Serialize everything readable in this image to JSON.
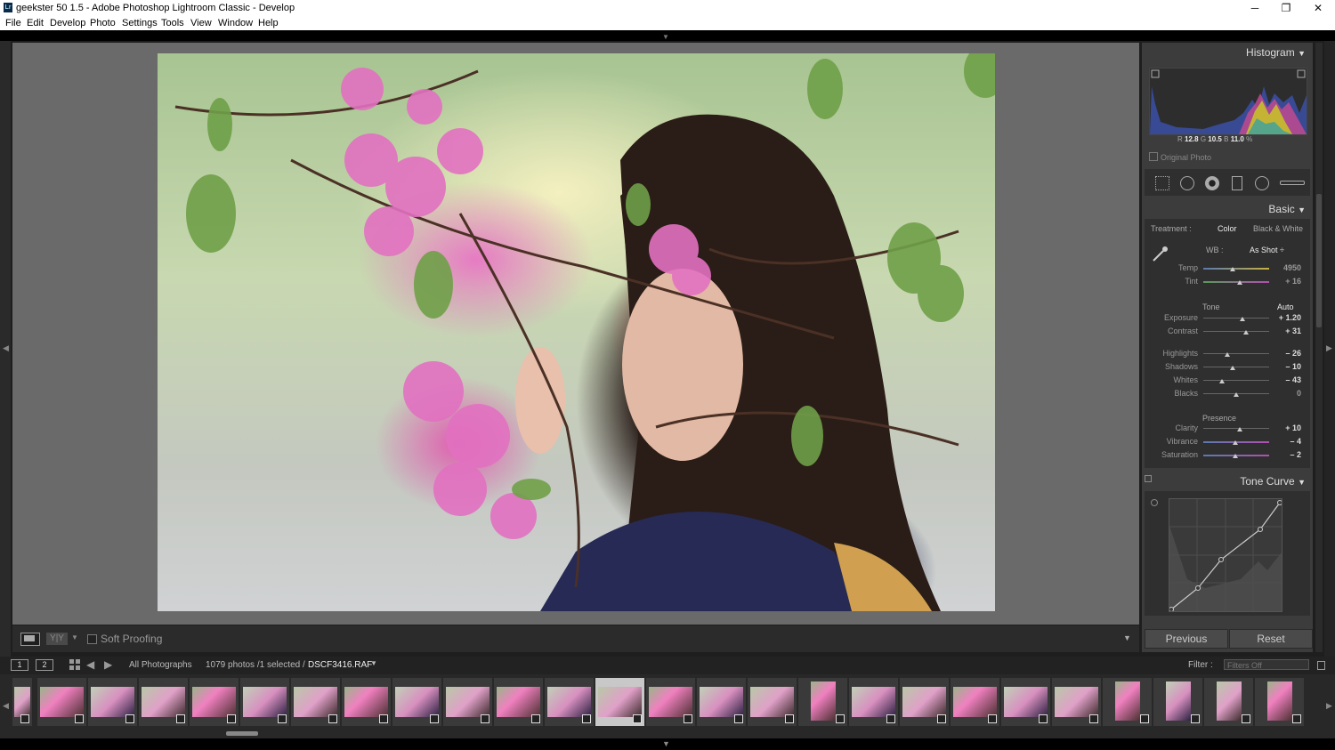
{
  "window": {
    "title": "geekster 50 1.5 - Adobe Photoshop Lightroom Classic - Develop",
    "app_icon": "Lr",
    "minimize": "─",
    "maximize": "❐",
    "close": "✕"
  },
  "menu": [
    "File",
    "Edit",
    "Develop",
    "Photo",
    "Settings",
    "Tools",
    "View",
    "Window",
    "Help"
  ],
  "toolbar": {
    "soft_proofing": "Soft Proofing",
    "view_mode": "Y|Y"
  },
  "histogram": {
    "title": "Histogram",
    "r_label": "R",
    "r": "12.8",
    "g_label": "G",
    "g": "10.5",
    "b_label": "B",
    "b": "11.0",
    "unit": "%",
    "original_photo": "Original Photo"
  },
  "basic": {
    "title": "Basic",
    "treatment_label": "Treatment :",
    "treatment_color": "Color",
    "treatment_bw": "Black & White",
    "wb_label": "WB :",
    "wb_value": "As Shot ÷",
    "temp": {
      "label": "Temp",
      "value": "4950",
      "level": 0.45
    },
    "tint": {
      "label": "Tint",
      "value": "+ 16",
      "level": 0.55
    },
    "tone_label": "Tone",
    "auto": "Auto",
    "exposure": {
      "label": "Exposure",
      "value": "+ 1.20",
      "level": 0.6
    },
    "contrast": {
      "label": "Contrast",
      "value": "+ 31",
      "level": 0.65
    },
    "highlights": {
      "label": "Highlights",
      "value": "– 26",
      "level": 0.37
    },
    "shadows": {
      "label": "Shadows",
      "value": "– 10",
      "level": 0.45
    },
    "whites": {
      "label": "Whites",
      "value": "– 43",
      "level": 0.28
    },
    "blacks": {
      "label": "Blacks",
      "value": "0",
      "level": 0.5
    },
    "presence_label": "Presence",
    "clarity": {
      "label": "Clarity",
      "value": "+ 10",
      "level": 0.55
    },
    "vibrance": {
      "label": "Vibrance",
      "value": "– 4",
      "level": 0.48
    },
    "saturation": {
      "label": "Saturation",
      "value": "– 2",
      "level": 0.49
    }
  },
  "tone_curve": {
    "title": "Tone Curve"
  },
  "buttons": {
    "previous": "Previous",
    "reset": "Reset"
  },
  "filmbar": {
    "page1": "1",
    "page2": "2",
    "source": "All Photographs",
    "count": "1079 photos /1 selected /",
    "filename": "DSCF3416.RAF",
    "filter_label": "Filter :",
    "filter_value": "Filters Off"
  }
}
